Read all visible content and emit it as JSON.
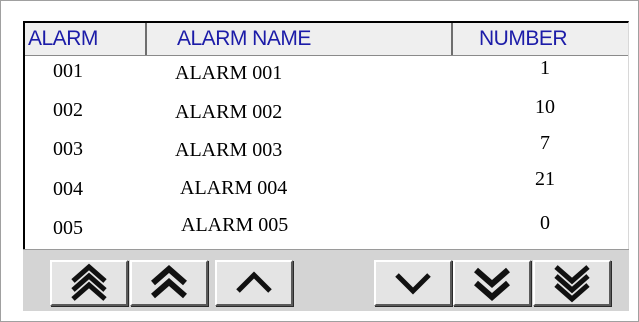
{
  "table": {
    "columns": {
      "alarm": "ALARM",
      "alarm_name": "ALARM NAME",
      "number": "NUMBER"
    },
    "rows": [
      {
        "id": "001",
        "name": "ALARM 001",
        "number": "1"
      },
      {
        "id": "002",
        "name": "ALARM 002",
        "number": "10"
      },
      {
        "id": "003",
        "name": "ALARM 003",
        "number": "7"
      },
      {
        "id": "004",
        "name": "ALARM 004",
        "number": "21"
      },
      {
        "id": "005",
        "name": "ALARM 005",
        "number": "0"
      }
    ]
  },
  "toolbar": {
    "buttons": [
      {
        "name": "first-page-button",
        "icon": "triple-chevron-up-icon"
      },
      {
        "name": "page-up-button",
        "icon": "double-chevron-up-icon"
      },
      {
        "name": "line-up-button",
        "icon": "chevron-up-icon"
      },
      {
        "name": "line-down-button",
        "icon": "chevron-down-icon"
      },
      {
        "name": "page-down-button",
        "icon": "double-chevron-down-icon"
      },
      {
        "name": "last-page-button",
        "icon": "triple-chevron-down-icon"
      }
    ]
  },
  "colors": {
    "header_text": "#1c1ca8",
    "header_bg": "#efefef",
    "toolbar_bg": "#d4d4d4"
  }
}
